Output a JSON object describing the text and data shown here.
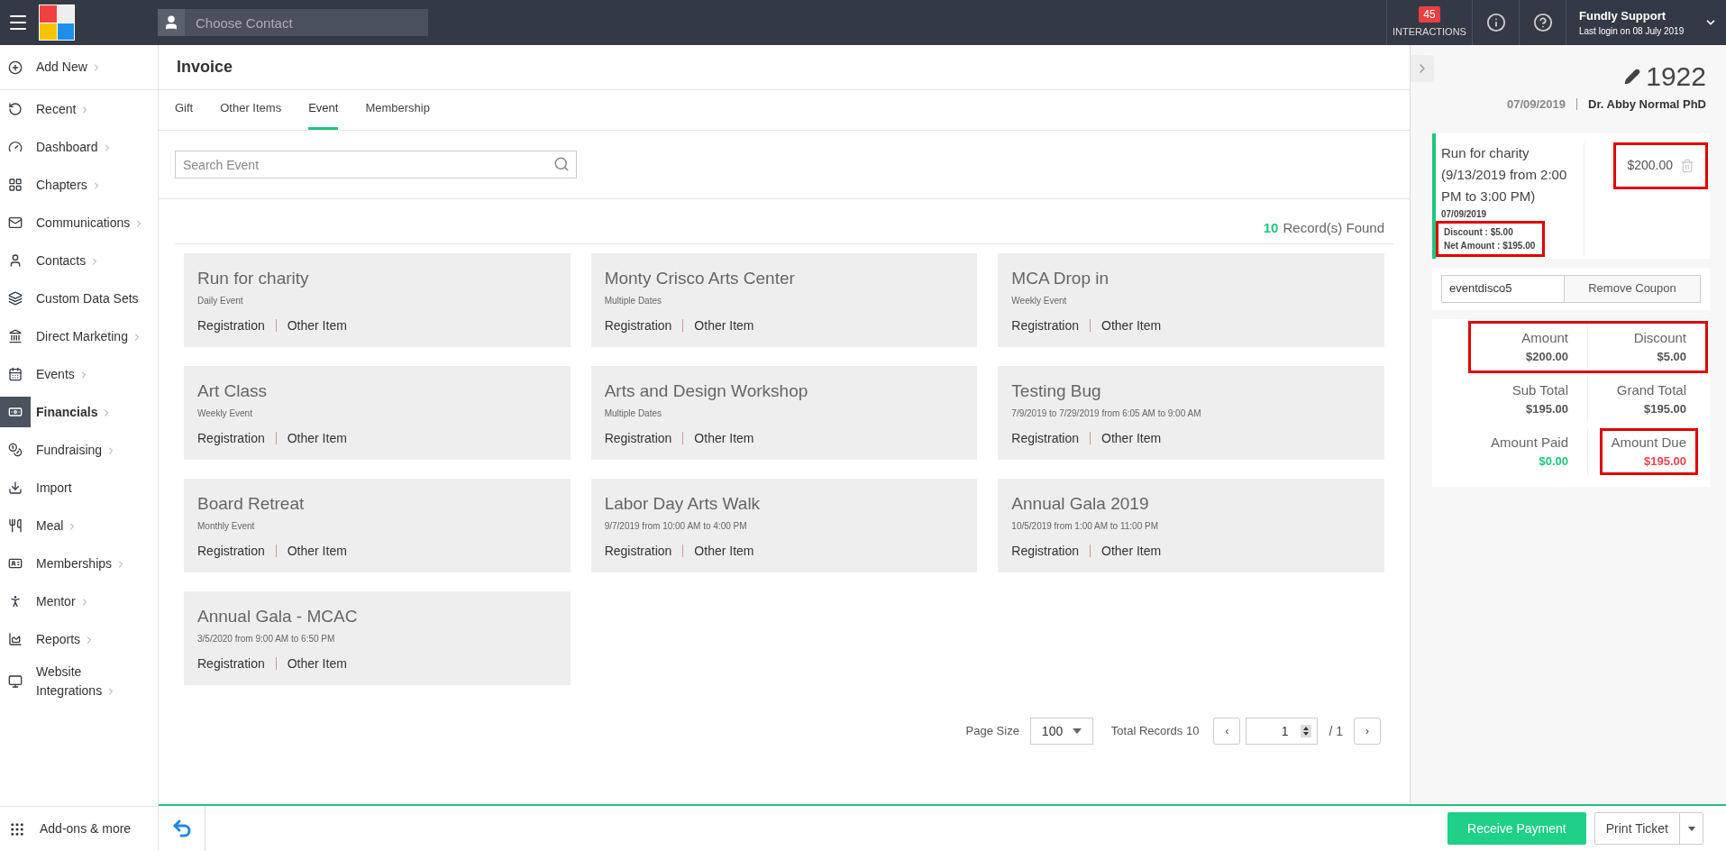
{
  "topbar": {
    "search_placeholder": "Choose Contact",
    "interactions": {
      "count": "45",
      "label": "INTERACTIONS"
    },
    "user": {
      "name": "Fundly Support",
      "last_login": "Last login on 08 July 2019"
    }
  },
  "sidebar": {
    "items": [
      {
        "label": "Add New",
        "chevron": true,
        "selected": false
      },
      {
        "label": "Recent",
        "chevron": true,
        "selected": false
      },
      {
        "label": "Dashboard",
        "chevron": true,
        "selected": false
      },
      {
        "label": "Chapters",
        "chevron": true,
        "selected": false
      },
      {
        "label": "Communications",
        "chevron": true,
        "selected": false
      },
      {
        "label": "Contacts",
        "chevron": true,
        "selected": false
      },
      {
        "label": "Custom Data Sets",
        "chevron": false,
        "selected": false
      },
      {
        "label": "Direct Marketing",
        "chevron": true,
        "selected": false
      },
      {
        "label": "Events",
        "chevron": true,
        "selected": false
      },
      {
        "label": "Financials",
        "chevron": true,
        "selected": true
      },
      {
        "label": "Fundraising",
        "chevron": true,
        "selected": false
      },
      {
        "label": "Import",
        "chevron": false,
        "selected": false
      },
      {
        "label": "Meal",
        "chevron": true,
        "selected": false
      },
      {
        "label": "Memberships",
        "chevron": true,
        "selected": false
      },
      {
        "label": "Mentor",
        "chevron": true,
        "selected": false
      },
      {
        "label": "Reports",
        "chevron": true,
        "selected": false
      },
      {
        "label": "Website Integrations",
        "chevron": true,
        "selected": false
      }
    ],
    "footer": "Add-ons & more"
  },
  "page_title": "Invoice",
  "tabs": [
    {
      "label": "Gift",
      "selected": false
    },
    {
      "label": "Other Items",
      "selected": false
    },
    {
      "label": "Event",
      "selected": true
    },
    {
      "label": "Membership",
      "selected": false
    }
  ],
  "search": {
    "placeholder": "Search Event"
  },
  "records": {
    "count": "10",
    "label": "Record(s) Found"
  },
  "events": [
    {
      "title": "Run for charity",
      "subtitle": "Daily Event",
      "links": [
        "Registration",
        "Other Item"
      ]
    },
    {
      "title": "Monty Crisco Arts Center",
      "subtitle": "Multiple Dates",
      "links": [
        "Registration",
        "Other Item"
      ]
    },
    {
      "title": "MCA Drop in",
      "subtitle": "Weekly Event",
      "links": [
        "Registration",
        "Other Item"
      ]
    },
    {
      "title": "Art Class",
      "subtitle": "Weekly Event",
      "links": [
        "Registration",
        "Other Item"
      ]
    },
    {
      "title": "Arts and Design Workshop",
      "subtitle": "Multiple Dates",
      "links": [
        "Registration",
        "Other Item"
      ]
    },
    {
      "title": "Testing Bug",
      "subtitle": "7/9/2019 to 7/29/2019 from 6:05 AM to 9:00 AM",
      "links": [
        "Registration",
        "Other Item"
      ]
    },
    {
      "title": "Board Retreat",
      "subtitle": "Monthly Event",
      "links": [
        "Registration",
        "Other Item"
      ]
    },
    {
      "title": "Labor Day Arts Walk",
      "subtitle": "9/7/2019 from 10:00 AM to 4:00 PM",
      "links": [
        "Registration",
        "Other Item"
      ]
    },
    {
      "title": "Annual Gala 2019",
      "subtitle": "10/5/2019 from 1:00 AM to 11:00 PM",
      "links": [
        "Registration",
        "Other Item"
      ]
    },
    {
      "title": "Annual Gala - MCAC",
      "subtitle": "3/5/2020 from 9:00 AM to 6:50 PM",
      "links": [
        "Registration",
        "Other Item"
      ]
    }
  ],
  "pagination": {
    "page_size_label": "Page Size",
    "page_size": "100",
    "total_records": "Total Records 10",
    "prev": "‹",
    "page": "1",
    "of": "/ 1",
    "next": "›"
  },
  "invoice": {
    "number": "1922",
    "date": "07/09/2019",
    "contact": "Dr. Abby Normal PhD",
    "line_item": {
      "title": "Run for charity (9/13/2019 from 2:00 PM to 3:00 PM)",
      "date": "07/09/2019",
      "discount": "Discount : $5.00",
      "net_amount": "Net Amount : $195.00",
      "price": "$200.00",
      "price_highlighted": true,
      "discount_highlighted": true
    },
    "coupon": {
      "code": "eventdisco5",
      "button": "Remove Coupon"
    },
    "totals": [
      {
        "highlighted": true,
        "cells": [
          {
            "label": "Amount",
            "value": "$200.00",
            "color": "#555555",
            "highlighted": false
          },
          {
            "label": "Discount",
            "value": "$5.00",
            "color": "#555555",
            "highlighted": false
          }
        ]
      },
      {
        "highlighted": false,
        "cells": [
          {
            "label": "Sub Total",
            "value": "$195.00",
            "color": "#555555",
            "highlighted": false
          },
          {
            "label": "Grand Total",
            "value": "$195.00",
            "color": "#555555",
            "highlighted": false
          }
        ]
      },
      {
        "highlighted": false,
        "cells": [
          {
            "label": "Amount Paid",
            "value": "$0.00",
            "color": "#1ec67f",
            "highlighted": false
          },
          {
            "label": "Amount Due",
            "value": "$195.00",
            "color": "#f0434f",
            "highlighted": true
          }
        ]
      }
    ]
  },
  "footer": {
    "primary": "Receive Payment",
    "secondary": "Print Ticket"
  }
}
